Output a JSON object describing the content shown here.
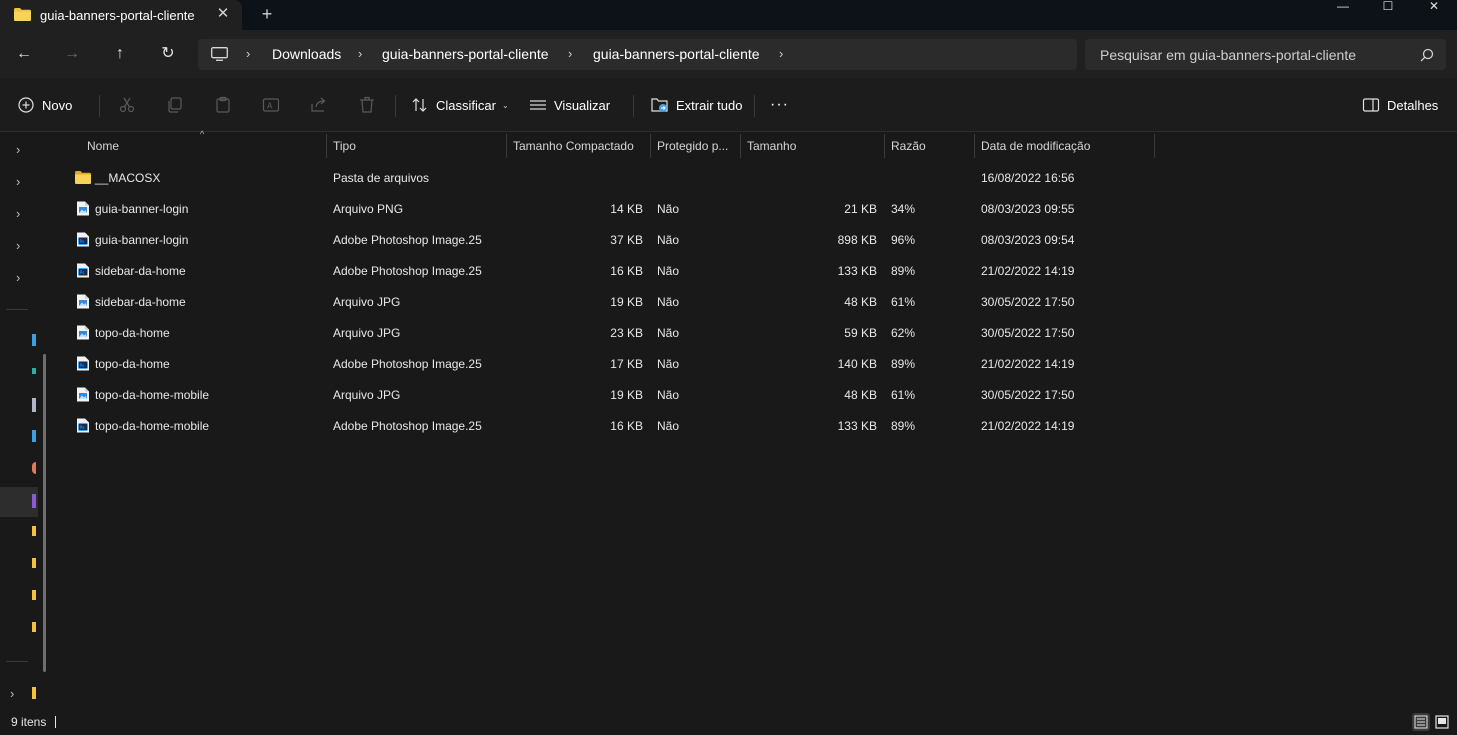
{
  "window": {
    "tab_title": "guia-banners-portal-cliente",
    "tab_close": "✕",
    "new_tab": "+",
    "minimize": "—",
    "maximize": "☐",
    "close": "✕"
  },
  "nav": {
    "back": "←",
    "forward": "→",
    "up": "↑",
    "refresh": "↻"
  },
  "breadcrumb": {
    "items": [
      "Downloads",
      "guia-banners-portal-cliente",
      "guia-banners-portal-cliente"
    ],
    "separator": "›"
  },
  "search": {
    "placeholder": "Pesquisar em guia-banners-portal-cliente"
  },
  "toolbar": {
    "new_label": "Novo",
    "sort_label": "Classificar",
    "view_label": "Visualizar",
    "extract_label": "Extrair tudo",
    "more_label": "···",
    "details_label": "Detalhes"
  },
  "columns": {
    "name": "Nome",
    "type": "Tipo",
    "compressed_size": "Tamanho Compactado",
    "protected": "Protegido p...",
    "size": "Tamanho",
    "ratio": "Razão",
    "modified": "Data de modificação"
  },
  "files": [
    {
      "name": "__MACOSX",
      "type": "Pasta de arquivos",
      "compressed": "",
      "protected": "",
      "size": "",
      "ratio": "",
      "modified": "16/08/2022 16:56",
      "icon": "folder-icon"
    },
    {
      "name": "guia-banner-login",
      "type": "Arquivo PNG",
      "compressed": "14 KB",
      "protected": "Não",
      "size": "21 KB",
      "ratio": "34%",
      "modified": "08/03/2023 09:55",
      "icon": "image-file-icon"
    },
    {
      "name": "guia-banner-login",
      "type": "Adobe Photoshop Image.25",
      "compressed": "37 KB",
      "protected": "Não",
      "size": "898 KB",
      "ratio": "96%",
      "modified": "08/03/2023 09:54",
      "icon": "photoshop-file-icon"
    },
    {
      "name": "sidebar-da-home",
      "type": "Adobe Photoshop Image.25",
      "compressed": "16 KB",
      "protected": "Não",
      "size": "133 KB",
      "ratio": "89%",
      "modified": "21/02/2022 14:19",
      "icon": "photoshop-file-icon"
    },
    {
      "name": "sidebar-da-home",
      "type": "Arquivo JPG",
      "compressed": "19 KB",
      "protected": "Não",
      "size": "48 KB",
      "ratio": "61%",
      "modified": "30/05/2022 17:50",
      "icon": "image-file-icon"
    },
    {
      "name": "topo-da-home",
      "type": "Arquivo JPG",
      "compressed": "23 KB",
      "protected": "Não",
      "size": "59 KB",
      "ratio": "62%",
      "modified": "30/05/2022 17:50",
      "icon": "image-file-icon"
    },
    {
      "name": "topo-da-home",
      "type": "Adobe Photoshop Image.25",
      "compressed": "17 KB",
      "protected": "Não",
      "size": "140 KB",
      "ratio": "89%",
      "modified": "21/02/2022 14:19",
      "icon": "photoshop-file-icon"
    },
    {
      "name": "topo-da-home-mobile",
      "type": "Arquivo JPG",
      "compressed": "19 KB",
      "protected": "Não",
      "size": "48 KB",
      "ratio": "61%",
      "modified": "30/05/2022 17:50",
      "icon": "image-file-icon"
    },
    {
      "name": "topo-da-home-mobile",
      "type": "Adobe Photoshop Image.25",
      "compressed": "16 KB",
      "protected": "Não",
      "size": "133 KB",
      "ratio": "89%",
      "modified": "21/02/2022 14:19",
      "icon": "photoshop-file-icon"
    }
  ],
  "status": {
    "item_count": "9 itens"
  },
  "colors": {
    "titlebar_bg": "#0d1118",
    "tab_bg": "#202020",
    "content_bg": "#191919",
    "folder_yellow": "#f3c13a",
    "accent_blue": "#4aa3df"
  }
}
